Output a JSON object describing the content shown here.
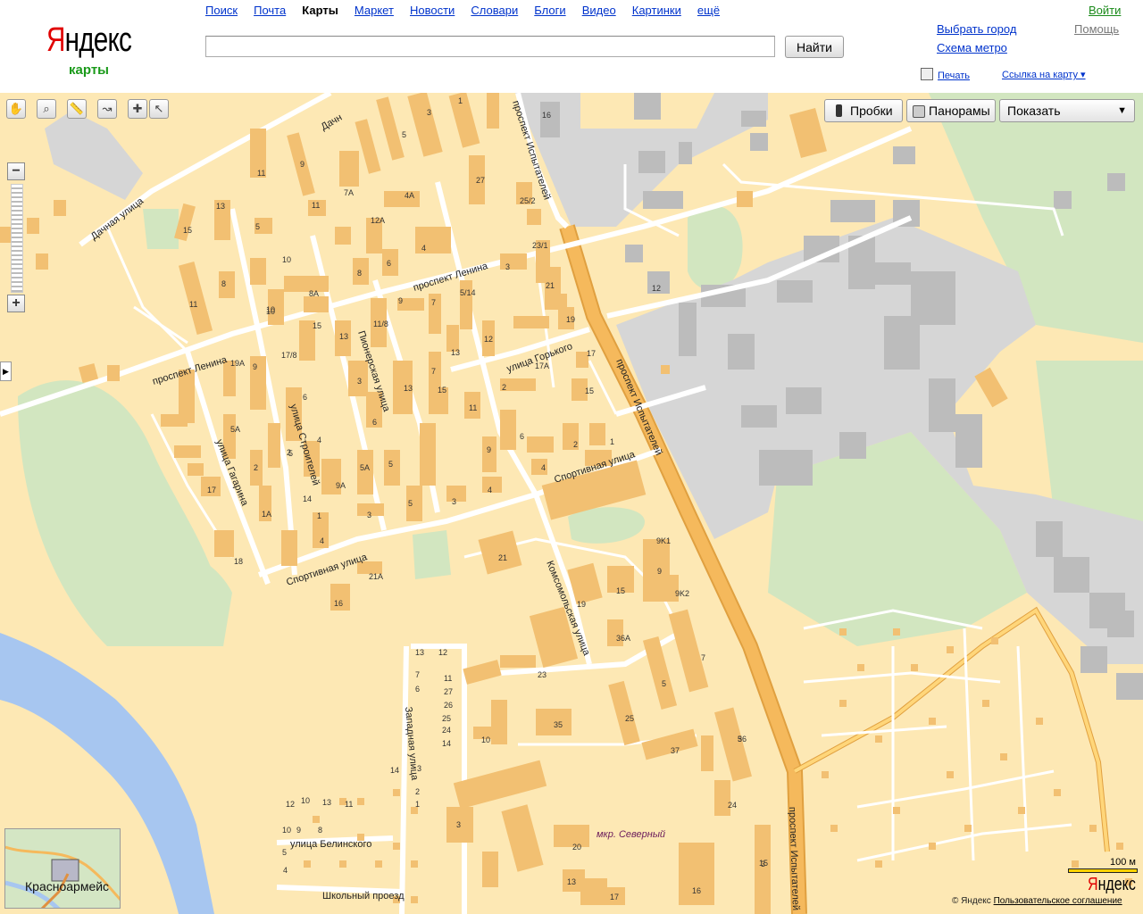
{
  "header": {
    "logo": {
      "first_letter": "Я",
      "rest": "ндекс"
    },
    "subtitle": "карты",
    "nav": [
      "Поиск",
      "Почта",
      "Карты",
      "Маркет",
      "Новости",
      "Словари",
      "Блоги",
      "Видео",
      "Картинки",
      "ещё"
    ],
    "nav_active_index": 2,
    "search": {
      "value": "",
      "button": "Найти"
    },
    "choose_city": "Выбрать город",
    "metro": "Схема метро",
    "login": "Войти",
    "help": "Помощь",
    "print": "Печать",
    "link_to_map": "Ссылка на карту ▾"
  },
  "map_controls": {
    "tools": [
      "hand-icon",
      "magnifier-icon",
      "ruler-icon",
      "route-icon",
      "placemark-icon",
      "cursor-icon"
    ],
    "zoom_in": "+",
    "zoom_out": "−",
    "traffic": "Пробки",
    "panoramas": "Панорамы",
    "show": "Показать",
    "show_arrow": "▼",
    "side_arrow": "▶"
  },
  "streets": {
    "dachnaya": "Дачная улица",
    "dachnaya_top": "Дачн",
    "ispytateley_top": "проспект Испытателей",
    "ispytateley_mid": "проспект Испытателей",
    "ispytateley_bottom": "проспект Испытателей",
    "lenina_1": "проспект Ленина",
    "lenina_2": "проспект Ленина",
    "pionerskaya": "Пионерская улица",
    "stroiteley": "улица Строителей",
    "gagarina": "улица Гагарина",
    "gorkogo": "улица Горького",
    "sportivnaya_1": "Спортивная улица",
    "sportivnaya_2": "Спортивная улица",
    "komsomolskaya": "Комсомольская улица",
    "zapadnaya": "Западная улица",
    "belinskogo": "улица Белинского",
    "shkolny": "Школьный проезд"
  },
  "district": "мкр. Северный",
  "house_numbers": [
    "16",
    "1",
    "3",
    "5",
    "27",
    "25/2",
    "23/1",
    "21",
    "19",
    "17",
    "15",
    "12",
    "9K1",
    "9",
    "9K2",
    "7",
    "5",
    "3",
    "11",
    "9",
    "7А",
    "4А",
    "12А",
    "13",
    "15",
    "11",
    "8",
    "5",
    "6",
    "4",
    "10",
    "8А",
    "10",
    "5/14",
    "3",
    "12",
    "9",
    "7",
    "11/8",
    "13",
    "15",
    "13",
    "17/8",
    "19А",
    "9",
    "11",
    "6",
    "3",
    "4",
    "5",
    "7",
    "8",
    "10",
    "13",
    "15",
    "17А",
    "11",
    "9",
    "6",
    "4",
    "2",
    "1",
    "2",
    "4",
    "3",
    "5",
    "9А",
    "1",
    "5А",
    "5",
    "3",
    "4",
    "6",
    "2",
    "14",
    "1А",
    "2",
    "5А",
    "17",
    "18",
    "21А",
    "16",
    "21",
    "19",
    "15",
    "36А",
    "23",
    "5",
    "25",
    "10",
    "35",
    "37",
    "36",
    "24",
    "3",
    "20",
    "13",
    "17",
    "16",
    "15",
    "14",
    "13",
    "12",
    "11",
    "27",
    "26",
    "25",
    "24",
    "14",
    "12",
    "10",
    "13",
    "11",
    "10",
    "9",
    "8",
    "7",
    "6",
    "5",
    "4",
    "3",
    "2",
    "1"
  ],
  "minimap_label": "Красноармейс",
  "scale": "100 м",
  "footer": {
    "yandex_logo_first": "Я",
    "yandex_logo_rest": "ндекс",
    "copyright": "© Яндекс",
    "agreement": "Пользовательское соглашение"
  },
  "colors": {
    "land": "#fde8b4",
    "building": "#f2c072",
    "industrial": "#d6d6d6",
    "industrial_building": "#bcbcbc",
    "green": "#d2e6c0",
    "water": "#a7c6f0",
    "main_road": "#f5b95c",
    "road": "#ffffff"
  }
}
